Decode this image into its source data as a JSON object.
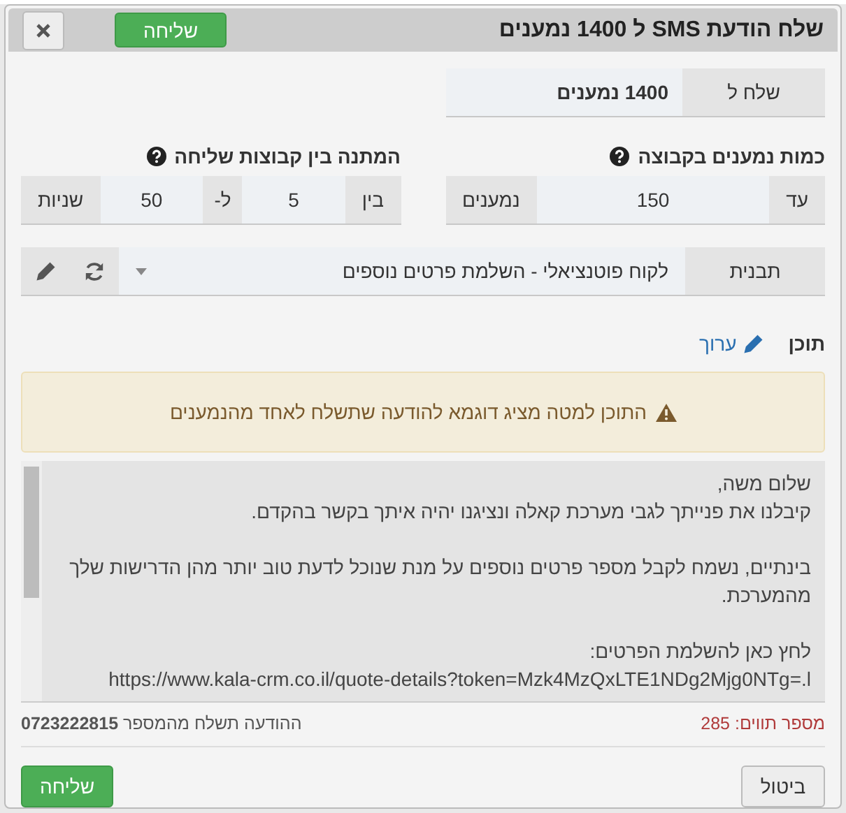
{
  "dialog": {
    "title": "שלח הודעת SMS ל 1400 נמענים",
    "header_send_button": "שליחה"
  },
  "send_to": {
    "label": "שלח ל",
    "value": "1400 נמענים"
  },
  "group_size": {
    "label": "כמות נמענים בקבוצה",
    "prefix": "עד",
    "value": "150",
    "suffix": "נמענים"
  },
  "group_delay": {
    "label": "המתנה בין קבוצות שליחה",
    "prefix": "בין",
    "from": "5",
    "separator": "ל-",
    "to": "50",
    "suffix": "שניות"
  },
  "template": {
    "label": "תבנית",
    "value": "לקוח פוטנציאלי - השלמת פרטים נוספים"
  },
  "content": {
    "label": "תוכן",
    "edit_link": "ערוך"
  },
  "alert": "התוכן למטה מציג דוגמא להודעה שתשלח לאחד מהנמענים",
  "message": {
    "paragraphs": [
      "שלום משה,\nקיבלנו את פנייתך לגבי מערכת קאלה ונציגנו יהיה איתך בקשר בהקדם.",
      "בינתיים, נשמח לקבל מספר פרטים נוספים על מנת שנוכל לדעת טוב יותר מהן הדרישות שלך מהמערכת.",
      "לחץ כאן להשלמת הפרטים:\nhttps://www.kala-crm.co.il/quote-details?token=Mzk4MzQxLTE1NDg2Mjg0NTg=.l"
    ]
  },
  "char_count": "מספר תווים: 285",
  "sender_note": "ההודעה תשלח מהמספר **0723222815**",
  "footer": {
    "cancel_button": "ביטול",
    "send_button": "שליחה"
  }
}
